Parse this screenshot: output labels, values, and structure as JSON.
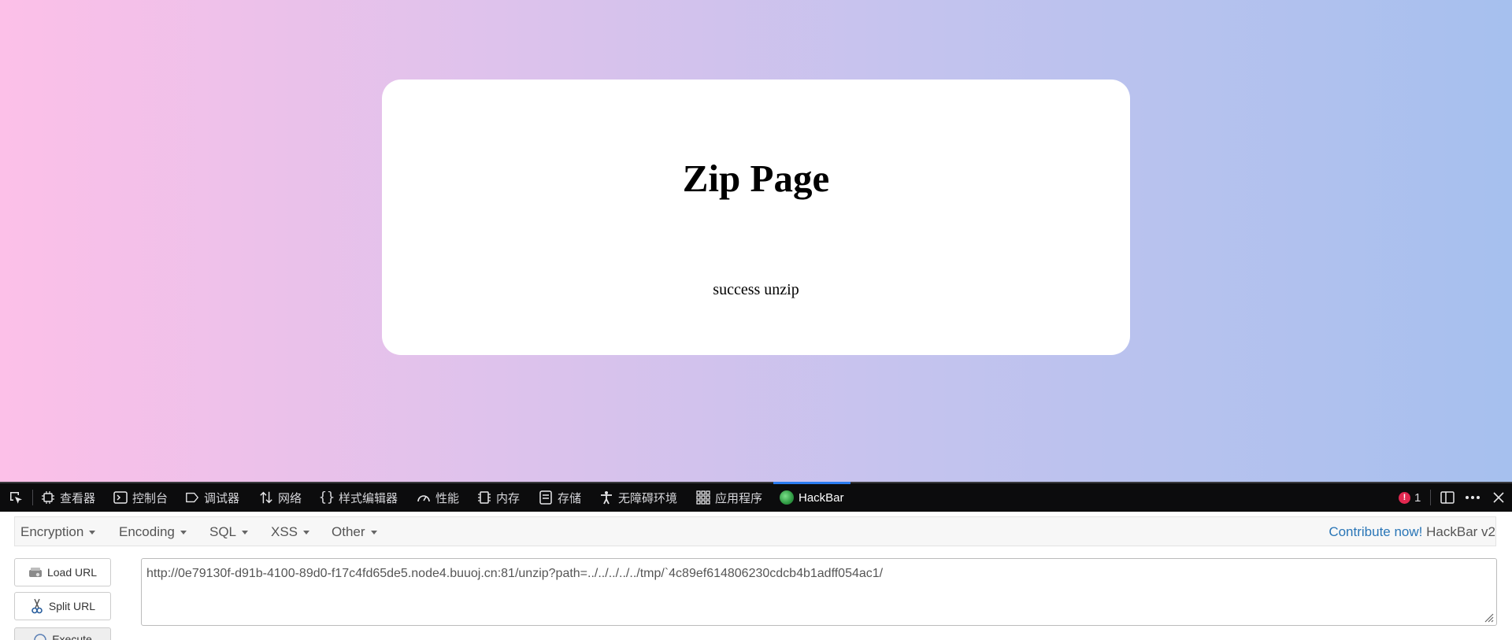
{
  "page": {
    "heading": "Zip Page",
    "message": "success unzip"
  },
  "devtools": {
    "tabs": [
      {
        "label": "查看器",
        "icon": "inspector-icon"
      },
      {
        "label": "控制台",
        "icon": "console-icon"
      },
      {
        "label": "调试器",
        "icon": "debugger-icon"
      },
      {
        "label": "网络",
        "icon": "network-icon"
      },
      {
        "label": "样式编辑器",
        "icon": "style-editor-icon"
      },
      {
        "label": "性能",
        "icon": "performance-icon"
      },
      {
        "label": "内存",
        "icon": "memory-icon"
      },
      {
        "label": "存储",
        "icon": "storage-icon"
      },
      {
        "label": "无障碍环境",
        "icon": "accessibility-icon"
      },
      {
        "label": "应用程序",
        "icon": "application-icon"
      },
      {
        "label": "HackBar",
        "icon": "hackbar-logo-icon",
        "active": true
      }
    ],
    "error_count": "1",
    "accent_color": "#2a7cf0"
  },
  "hackbar": {
    "menus": [
      "Encryption",
      "Encoding",
      "SQL",
      "XSS",
      "Other"
    ],
    "contribute_link": "Contribute now!",
    "version": "HackBar v2",
    "buttons": {
      "load_url": "Load URL",
      "split_url": "Split URL",
      "execute": "Execute"
    },
    "url_value": "http://0e79130f-d91b-4100-89d0-f17c4fd65de5.node4.buuoj.cn:81/unzip?path=../../../../../tmp/`4c89ef614806230cdcb4b1adff054ac1/"
  }
}
